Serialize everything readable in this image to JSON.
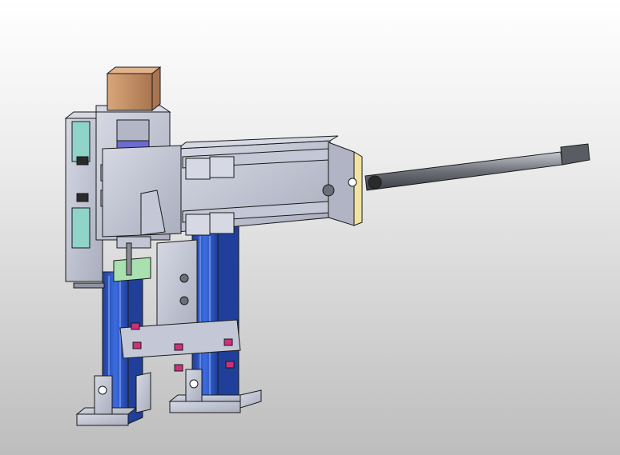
{
  "viewport": {
    "background_top": "#ffffff",
    "background_bottom": "#bdbdbd"
  },
  "model": {
    "colors": {
      "frame_steel": "#b8bccb",
      "frame_steel_dark": "#8f93a3",
      "frame_steel_light": "#d6d9e4",
      "aluminum_profile": "#2f5fd0",
      "aluminum_profile_dark": "#1f3f9a",
      "motor_body": "#c9956a",
      "motor_shade": "#a87550",
      "sensor_teal": "#8fd3c9",
      "clamp_green": "#a8e0b0",
      "bumper_magenta": "#d0307a",
      "rod_gray": "#8a8c94",
      "endcap_yellow": "#f1e3a0",
      "edge_black": "#1a1a1a"
    },
    "parts": [
      "stepper-motor",
      "vertical-base-plate",
      "horizontal-rail-beam",
      "pneumatic-cylinder-rod",
      "aluminum-extrusion-posts",
      "mounting-feet",
      "bumper-stops",
      "sensor-brackets",
      "guide-block-clamp"
    ]
  }
}
